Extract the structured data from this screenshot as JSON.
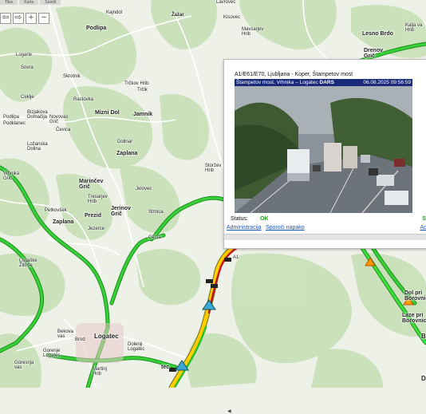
{
  "map": {
    "places": [
      {
        "id": "kajndol",
        "text": "Kajndol"
      },
      {
        "id": "zazar",
        "text": "Žažar"
      },
      {
        "id": "kisovec1",
        "text": "Kisovec"
      },
      {
        "id": "lavrovec",
        "text": "Lavrovec"
      },
      {
        "id": "podlipa",
        "text": "Podlipa"
      },
      {
        "id": "mavsarjev",
        "text": "Mavsarjev\nHrib"
      },
      {
        "id": "lesnobrdo",
        "text": "Lesno Brdo"
      },
      {
        "id": "drenov",
        "text": "Drenov\nGrič"
      },
      {
        "id": "kaljava",
        "text": "Kalja va\nHrib"
      },
      {
        "id": "logarle",
        "text": "Logarle"
      },
      {
        "id": "sovra",
        "text": "Sovra"
      },
      {
        "id": "skrotnik",
        "text": "Skrotnik"
      },
      {
        "id": "trckov",
        "text": "Trčkov Hrib"
      },
      {
        "id": "trcik",
        "text": "Trčik"
      },
      {
        "id": "ceklje",
        "text": "Ceklje"
      },
      {
        "id": "rastovka",
        "text": "Rastovka"
      },
      {
        "id": "bizjakova",
        "text": "Bizjakova\nDomačija"
      },
      {
        "id": "podlipa2",
        "text": "Podlipa"
      },
      {
        "id": "novovas",
        "text": "Novovas\nGrič"
      },
      {
        "id": "mizni",
        "text": "Mizni Dol"
      },
      {
        "id": "jamnik",
        "text": "Jamnik"
      },
      {
        "id": "podklanec",
        "text": "Podklanec"
      },
      {
        "id": "cevica",
        "text": "Čevica"
      },
      {
        "id": "loznabrda",
        "text": "Ložanska\nDolina"
      },
      {
        "id": "zaplana1",
        "text": "Zaplana"
      },
      {
        "id": "dolinar",
        "text": "Dolinar"
      },
      {
        "id": "storzev",
        "text": "Storžev\nHrib"
      },
      {
        "id": "vrhnika",
        "text": "Vrhnika\nGrič"
      },
      {
        "id": "marincev",
        "text": "Marinčev\nGrič"
      },
      {
        "id": "jelovec",
        "text": "Jelovec"
      },
      {
        "id": "tresarjev",
        "text": "Tresarjev\nHrib"
      },
      {
        "id": "petkovsek",
        "text": "Petkovšek"
      },
      {
        "id": "prezid",
        "text": "Prezid"
      },
      {
        "id": "jerinov",
        "text": "Jerinov\nGrič"
      },
      {
        "id": "strnica",
        "text": "Strnica"
      },
      {
        "id": "zaplana2",
        "text": "Zaplana"
      },
      {
        "id": "jezerce",
        "text": "Jezerce"
      },
      {
        "id": "cesta",
        "text": "Cesta"
      },
      {
        "id": "logaske",
        "text": "Logaške\nŽibrše"
      },
      {
        "id": "bekova",
        "text": "Bekova\nvas"
      },
      {
        "id": "brod",
        "text": "Brod"
      },
      {
        "id": "logatec",
        "text": "Logatec"
      },
      {
        "id": "gorenje",
        "text": "Gorenje\nLogatec"
      },
      {
        "id": "dolenji",
        "text": "Dolenji\nLogatec"
      },
      {
        "id": "goresnja",
        "text": "Goresnja\nvas"
      },
      {
        "id": "martinj",
        "text": "Martinj\nHrib"
      },
      {
        "id": "tec",
        "text": "tec"
      },
      {
        "id": "dolpri",
        "text": "Dol pri\nBorovnici"
      },
      {
        "id": "lazepri",
        "text": "Laze pri\nBorovnici"
      },
      {
        "id": "b_edge",
        "text": "B"
      },
      {
        "id": "d_edge",
        "text": "D"
      },
      {
        "id": "a1",
        "text": "A1"
      },
      {
        "id": "stampetov",
        "text": "Štampetov\nmost"
      }
    ],
    "toolbar": [
      "⇦",
      "⇨",
      "+",
      "−"
    ],
    "toptabs": [
      "Tiles",
      "Karta",
      "Satelit"
    ]
  },
  "popup": {
    "title": "A1/E61/E70, Ljubljana - Koper, Štampetov most",
    "camera_caption_left": "Štampetov most, Vrhnika – Logatec",
    "camera_caption_brand": "DARS",
    "camera_timestamp": "06.08.2025 09:56:59",
    "status_label": "Status:",
    "status_value": "OK",
    "link_admin": "Administracija",
    "link_report": "Sporoči napako",
    "cut_status": "S",
    "cut_link": "Ad"
  },
  "colors": {
    "traffic_free": "#1fb51f",
    "traffic_slow": "#ffcc00",
    "traffic_jam": "#c01818",
    "status_ok": "#1c9a1c",
    "link": "#1a55c4",
    "camera_bar": "#1a2a7a"
  }
}
